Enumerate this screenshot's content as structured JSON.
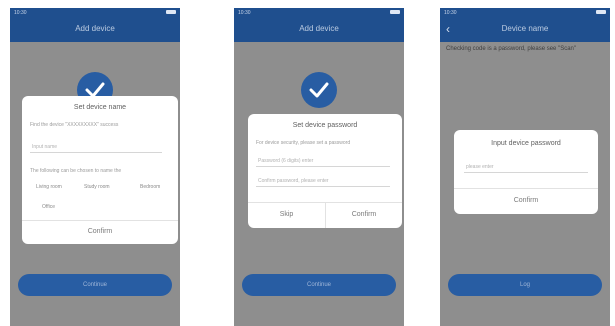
{
  "phone1": {
    "nav_title": "Add device",
    "dialog": {
      "title": "Set device name",
      "prompt": "Find the device \"XXXXXXXXX\" success",
      "name_placeholder": "Input name",
      "recommend_text": "The following can be chosen to name the",
      "choices": [
        "Living room",
        "Study room",
        "Bedroom",
        "Office"
      ],
      "confirm": "Confirm"
    },
    "button": "Continue"
  },
  "phone2": {
    "nav_title": "Add device",
    "dialog": {
      "title": "Set device password",
      "prompt": "For device security, please set a password",
      "password_placeholder": "Password (6 digits) enter",
      "confirm_placeholder": "Confirm password, please enter",
      "skip": "Skip",
      "confirm": "Confirm"
    },
    "button": "Continue"
  },
  "phone3": {
    "back_icon": "chevron-left",
    "nav_title": "Device name",
    "hint": "Checking code is a password, please see \"Scan\"",
    "dialog": {
      "title": "Input device password",
      "placeholder": "please enter",
      "confirm": "Confirm"
    },
    "button": "Log"
  },
  "colors": {
    "brand": "#1f4f8e",
    "accent": "#285da3",
    "overlay": "#8e8e8e"
  }
}
